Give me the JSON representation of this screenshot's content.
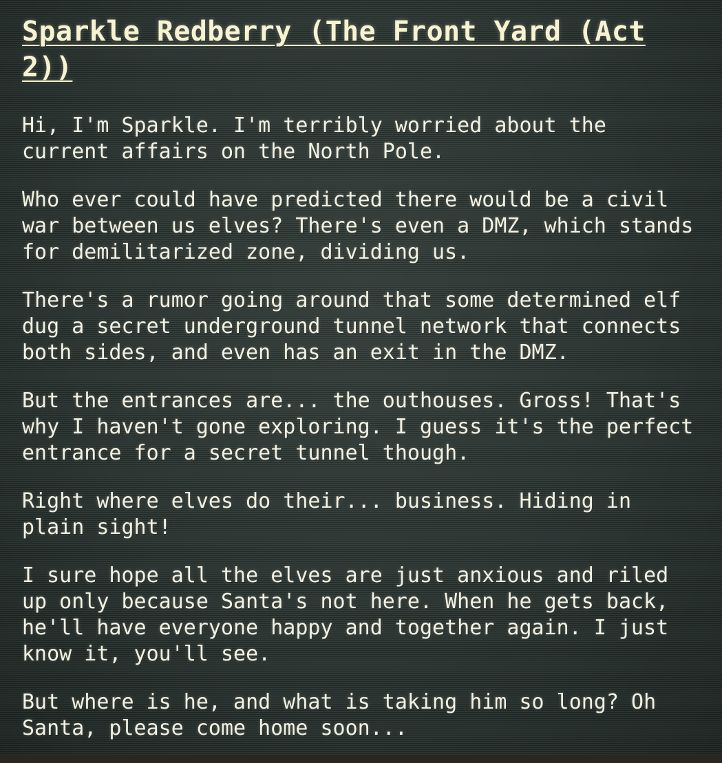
{
  "title": "Sparkle Redberry (The Front Yard (Act 2))",
  "dialogue": [
    {
      "lines": [
        "Hi, I'm Sparkle. I'm terribly worried about the",
        "current affairs on the North Pole."
      ]
    },
    {
      "lines": [
        "Who ever could have predicted there would be a civil",
        "war between us elves? There's even a DMZ, which stands",
        "for demilitarized zone, dividing us."
      ]
    },
    {
      "lines": [
        "There's a rumor going around that some determined elf",
        "dug a secret underground tunnel network that connects",
        "both sides, and even has an exit in the DMZ."
      ]
    },
    {
      "lines": [
        "But the entrances are... the outhouses. Gross! That's",
        "why I haven't gone exploring. I guess it's the perfect",
        "entrance for a secret tunnel though."
      ]
    },
    {
      "lines": [
        "Right where elves do their... business. Hiding in",
        "plain sight!"
      ]
    },
    {
      "lines": [
        "I sure hope all the elves are just anxious and riled",
        "up only because Santa's not here. When he gets back,",
        "he'll have everyone happy and together again. I just",
        "know it, you'll see."
      ]
    },
    {
      "lines": [
        "But where is he, and what is taking him so long? Oh",
        "Santa, please come home soon..."
      ]
    }
  ]
}
